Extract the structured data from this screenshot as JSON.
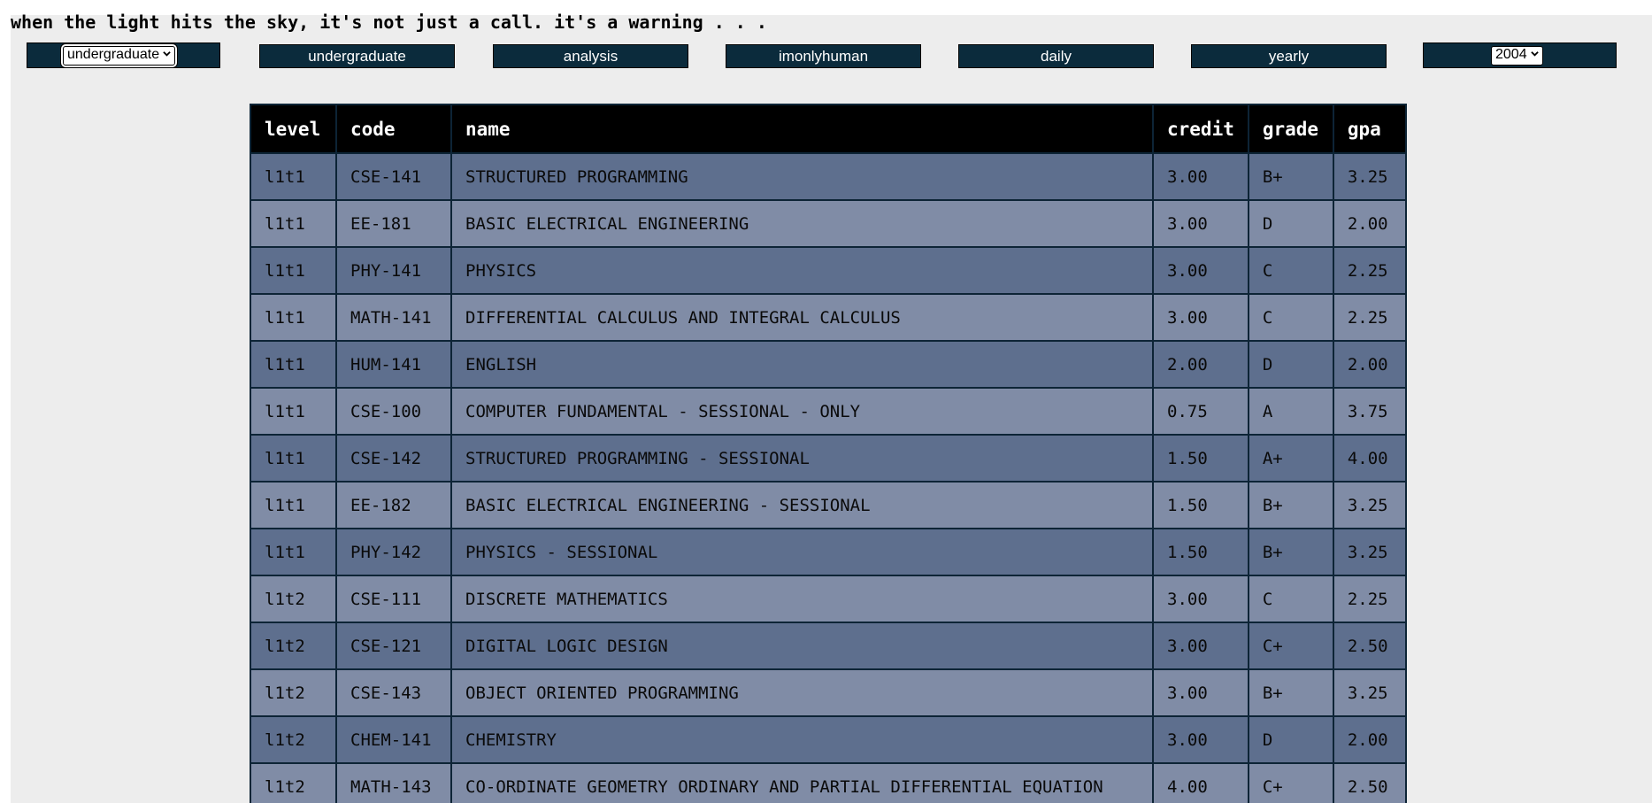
{
  "tagline": "when the light hits the sky, it's not just a call. it's a warning . . .",
  "nav": {
    "program_select": "undergraduate",
    "items": [
      "undergraduate",
      "analysis",
      "imonlyhuman",
      "daily",
      "yearly"
    ],
    "year_select": "2004"
  },
  "icons": {
    "select_arrow": "chevron-down-icon"
  },
  "colors": {
    "nav_bg": "#0b2b3c",
    "header_bg": "#000000",
    "row_dark": "#5e6f8e",
    "row_light": "#808ca6",
    "panel_bg": "#ededed"
  },
  "table": {
    "headers": [
      "level",
      "code",
      "name",
      "credit",
      "grade",
      "gpa"
    ],
    "rows": [
      [
        "l1t1",
        "CSE-141",
        "STRUCTURED PROGRAMMING",
        "3.00",
        "B+",
        "3.25"
      ],
      [
        "l1t1",
        "EE-181",
        "BASIC ELECTRICAL ENGINEERING",
        "3.00",
        "D",
        "2.00"
      ],
      [
        "l1t1",
        "PHY-141",
        "PHYSICS",
        "3.00",
        "C",
        "2.25"
      ],
      [
        "l1t1",
        "MATH-141",
        "DIFFERENTIAL CALCULUS AND INTEGRAL CALCULUS",
        "3.00",
        "C",
        "2.25"
      ],
      [
        "l1t1",
        "HUM-141",
        "ENGLISH",
        "2.00",
        "D",
        "2.00"
      ],
      [
        "l1t1",
        "CSE-100",
        "COMPUTER FUNDAMENTAL - SESSIONAL - ONLY",
        "0.75",
        "A",
        "3.75"
      ],
      [
        "l1t1",
        "CSE-142",
        "STRUCTURED PROGRAMMING - SESSIONAL",
        "1.50",
        "A+",
        "4.00"
      ],
      [
        "l1t1",
        "EE-182",
        "BASIC ELECTRICAL ENGINEERING - SESSIONAL",
        "1.50",
        "B+",
        "3.25"
      ],
      [
        "l1t1",
        "PHY-142",
        "PHYSICS - SESSIONAL",
        "1.50",
        "B+",
        "3.25"
      ],
      [
        "l1t2",
        "CSE-111",
        "DISCRETE MATHEMATICS",
        "3.00",
        "C",
        "2.25"
      ],
      [
        "l1t2",
        "CSE-121",
        "DIGITAL LOGIC DESIGN",
        "3.00",
        "C+",
        "2.50"
      ],
      [
        "l1t2",
        "CSE-143",
        "OBJECT ORIENTED PROGRAMMING",
        "3.00",
        "B+",
        "3.25"
      ],
      [
        "l1t2",
        "CHEM-141",
        "CHEMISTRY",
        "3.00",
        "D",
        "2.00"
      ],
      [
        "l1t2",
        "MATH-143",
        "CO-ORDINATE GEOMETRY ORDINARY AND PARTIAL DIFFERENTIAL EQUATION",
        "4.00",
        "C+",
        "2.50"
      ]
    ]
  }
}
